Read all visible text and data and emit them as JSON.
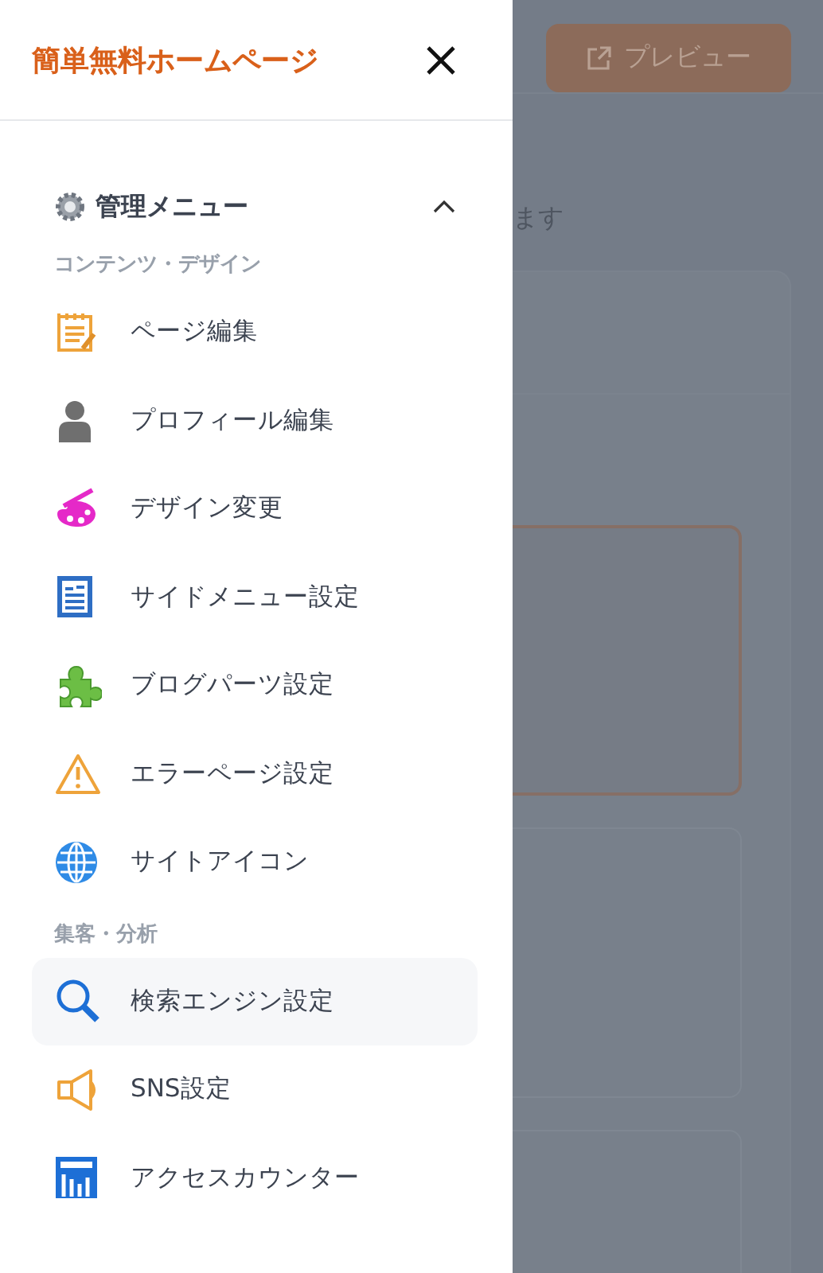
{
  "drawer": {
    "title": "簡単無料ホームページ"
  },
  "menu": {
    "title": "管理メニュー",
    "expanded": true,
    "sections": [
      {
        "heading": "コンテンツ・デザイン",
        "items": [
          {
            "label": "ページ編集",
            "selected": false
          },
          {
            "label": "プロフィール編集",
            "selected": false
          },
          {
            "label": "デザイン変更",
            "selected": false
          },
          {
            "label": "サイドメニュー設定",
            "selected": false
          },
          {
            "label": "ブログパーツ設定",
            "selected": false
          },
          {
            "label": "エラーページ設定",
            "selected": false
          },
          {
            "label": "サイトアイコン",
            "selected": false
          }
        ]
      },
      {
        "heading": "集客・分析",
        "items": [
          {
            "label": "検索エンジン設定",
            "selected": true
          },
          {
            "label": "SNS設定",
            "selected": false
          },
          {
            "label": "アクセスカウンター",
            "selected": false
          }
        ]
      }
    ]
  },
  "background": {
    "preview_button": "プレビュー",
    "text": "ます"
  }
}
